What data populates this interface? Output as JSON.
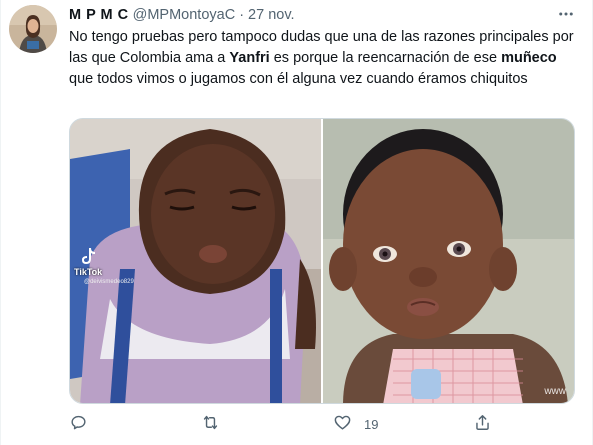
{
  "tweet": {
    "author_name": "M P M C",
    "handle": "@MPMontoyaC",
    "separator": "·",
    "date": "27 nov.",
    "text": {
      "p1": "No tengo pruebas pero tampoco dudas que una de las razones principales por las que Colombia ama a ",
      "b1": "Yanfri",
      "p2": " es porque la reencarnación de ese ",
      "b2": "muñeco",
      "p3": " que todos vimos o jugamos con él alguna vez cuando éramos chiquitos"
    }
  },
  "media": {
    "left_watermark": "TikTok",
    "left_user": "@deivismedeo829",
    "right_watermark": "www"
  },
  "actions": {
    "reply_count": "",
    "retweet_count": "",
    "like_count": "19"
  },
  "colors": {
    "text": "#0f1419",
    "secondary": "#536471",
    "border": "#cfd9de"
  },
  "icons": [
    "avatar",
    "more-icon",
    "reply-icon",
    "retweet-icon",
    "like-icon",
    "share-icon",
    "tiktok-icon"
  ]
}
